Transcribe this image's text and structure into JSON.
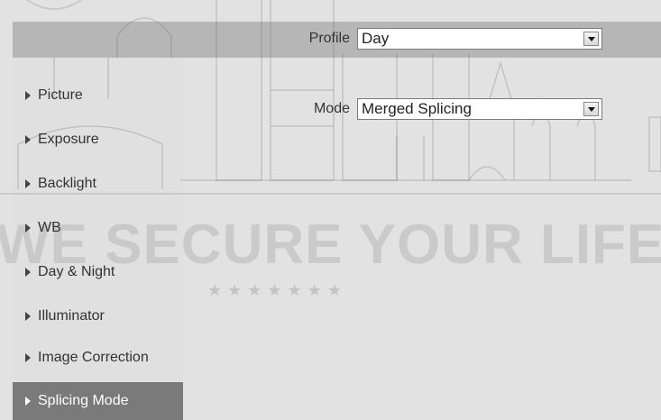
{
  "form": {
    "profile_label": "Profile",
    "profile_value": "Day",
    "mode_label": "Mode",
    "mode_value": "Merged Splicing"
  },
  "sidebar": {
    "items": [
      {
        "label": "Picture"
      },
      {
        "label": "Exposure"
      },
      {
        "label": "Backlight"
      },
      {
        "label": "WB"
      },
      {
        "label": "Day & Night"
      },
      {
        "label": "Illuminator"
      },
      {
        "label": "Image Correction"
      },
      {
        "label": "Splicing Mode"
      }
    ],
    "active_index": 7
  },
  "watermark": {
    "tagline": "WE SECURE YOUR LIFE",
    "stars": "★★★★★★★"
  },
  "colors": {
    "background": "#e2e2e2",
    "header_bar": "#b6b6b6",
    "active_item": "#7a7a7a"
  }
}
